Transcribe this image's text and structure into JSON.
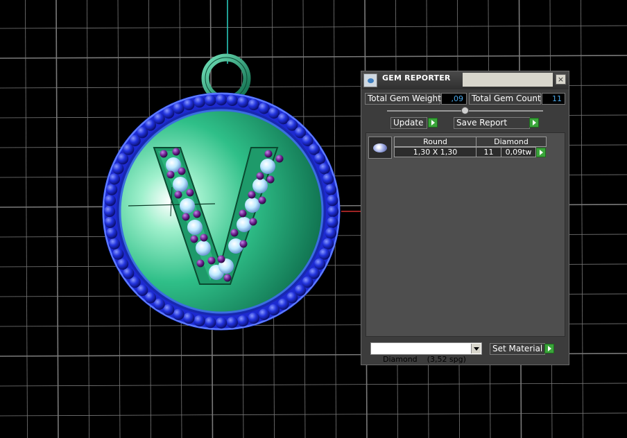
{
  "window": {
    "title": "GEM REPORTER",
    "close_label": "×"
  },
  "totals": {
    "weight_label": "Total Gem Weight",
    "weight_value": ",09",
    "count_label": "Total Gem Count",
    "count_value": "11"
  },
  "actions": {
    "update_label": "Update",
    "save_report_label": "Save Report"
  },
  "gem_table": {
    "header": {
      "shape": "Round",
      "material": "Diamond"
    },
    "row": {
      "size": "1,30 X 1,30",
      "count": "11",
      "weight": "0,09tw"
    }
  },
  "material": {
    "selected": "Diamond    (3,52 spg)",
    "set_label": "Set Material"
  },
  "colors": {
    "pendant": "#2fbf88",
    "beads": "#2233dd",
    "gems": "#9be2ff",
    "prongs": "#6a1f8c",
    "panel": "#3c3c3c",
    "accent_button": "#3aa53a"
  }
}
